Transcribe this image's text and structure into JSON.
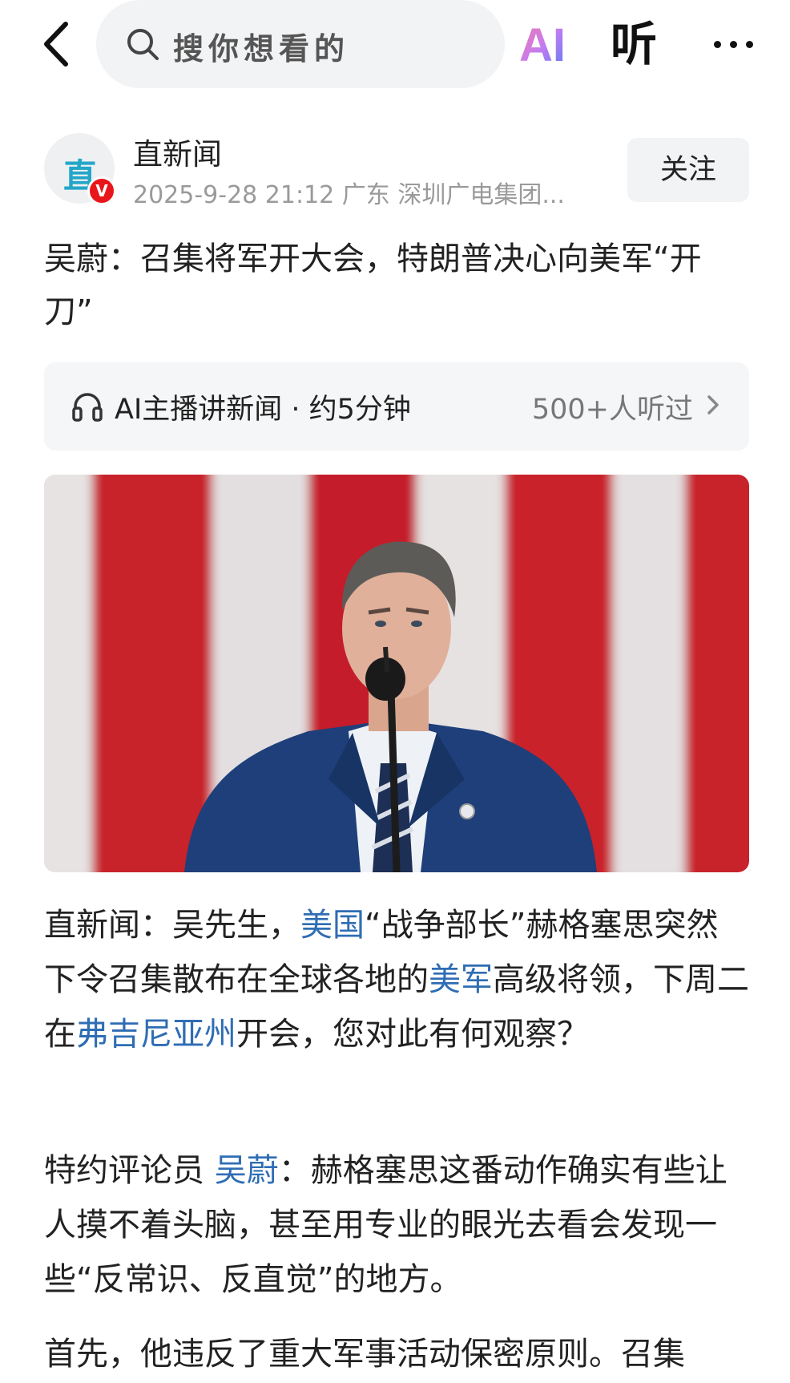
{
  "search": {
    "placeholder": "搜你想看的"
  },
  "topbar": {
    "ai_label": "AI",
    "listen_label": "听"
  },
  "publisher": {
    "avatar_text": "直",
    "verified_badge": "V",
    "name": "直新闻",
    "meta": "2025-9-28  21:12  广东  深圳广电集团...",
    "follow_label": "关注"
  },
  "article": {
    "title": "吴蔚：召集将军开大会，特朗普决心向美军“开刀”",
    "listen_bar": {
      "label": "AI主播讲新闻 · 约5分钟",
      "count": "500+人听过"
    },
    "p1": {
      "a": "直新闻：吴先生，",
      "link1": "美国",
      "b": "“战争部长”赫格塞思突然下令召集散布在全球各地的",
      "link2": "美军",
      "c": "高级将领，下周二在",
      "link3": "弗吉尼亚州",
      "d": "开会，您对此有何观察？"
    },
    "p2": {
      "a": "特约评论员 ",
      "link1": "吴蔚",
      "b": "：赫格塞思这番动作确实有些让人摸不着头脑，甚至用专业的眼光去看会发现一些“反常识、反直觉”的地方。"
    },
    "p3": {
      "text": "首先，他违反了重大军事活动保密原则。召集"
    }
  },
  "colors": {
    "link": "#2f6db4",
    "verified": "#e8161b",
    "avatar_mark": "#23a6c8",
    "flag_red": "#c8202a",
    "suit": "#1e3f7a"
  },
  "icons": {
    "back": "chevron-left-icon",
    "search": "search-icon",
    "more": "more-icon",
    "headphone": "headphone-icon",
    "chevron": "chevron-right-icon"
  }
}
